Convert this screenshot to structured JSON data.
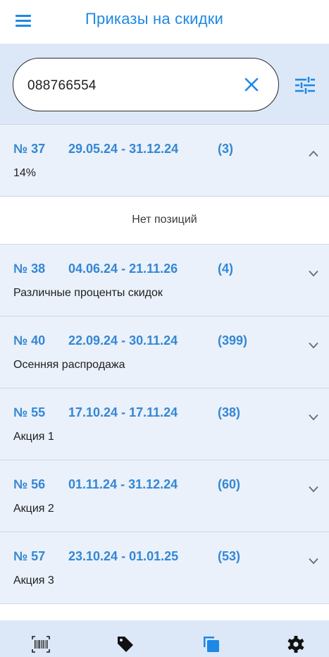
{
  "header": {
    "title": "Приказы на скидки",
    "menu_icon": "menu-icon",
    "accent_color": "#1e88e5"
  },
  "search": {
    "value": "088766554",
    "clear_icon": "close-icon",
    "filter_icon": "tune-icon"
  },
  "orders": [
    {
      "number": "№ 37",
      "period": "29.05.24 - 31.12.24",
      "count": "(3)",
      "description": "14%",
      "expanded": true,
      "items_text": "Нет позиций"
    },
    {
      "number": "№ 38",
      "period": "04.06.24 - 21.11.26",
      "count": "(4)",
      "description": "Различные проценты скидок",
      "expanded": false
    },
    {
      "number": "№ 40",
      "period": "22.09.24 - 30.11.24",
      "count": "(399)",
      "description": "Осенняя распродажа",
      "expanded": false
    },
    {
      "number": "№ 55",
      "period": "17.10.24 - 17.11.24",
      "count": "(38)",
      "description": "Акция 1",
      "expanded": false
    },
    {
      "number": "№ 56",
      "period": "01.11.24 - 31.12.24",
      "count": "(60)",
      "description": "Акция 2",
      "expanded": false
    },
    {
      "number": "№ 57",
      "period": "23.10.24 - 01.01.25",
      "count": "(53)",
      "description": "Акция 3",
      "expanded": false
    }
  ],
  "bottom_nav": [
    {
      "icon": "barcode-scanner-icon"
    },
    {
      "icon": "price-tag-icon"
    },
    {
      "icon": "copy-icon"
    },
    {
      "icon": "settings-icon"
    }
  ]
}
